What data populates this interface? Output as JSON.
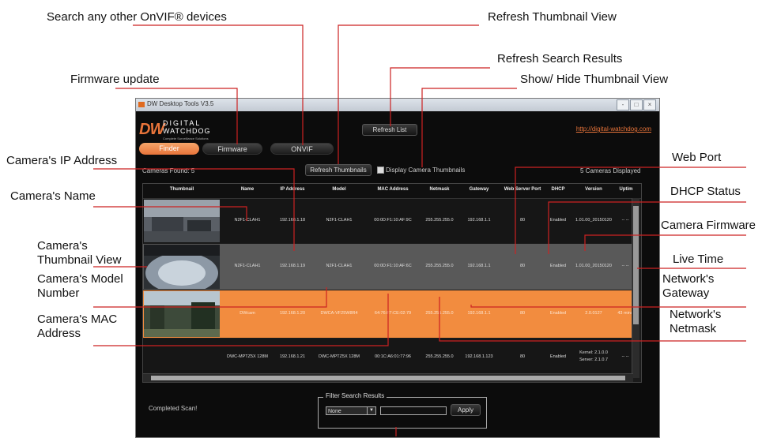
{
  "annotations": {
    "search_onvif": "Search any other OnVIF® devices",
    "refresh_thumbnail_view": "Refresh Thumbnail View",
    "refresh_search_results": "Refresh Search Results",
    "firmware_update": "Firmware update",
    "show_hide_thumbnail": "Show/ Hide Thumbnail View",
    "camera_ip": "Camera's IP Address",
    "web_port": "Web Port",
    "camera_name": "Camera's Name",
    "dhcp_status": "DHCP Status",
    "camera_firmware": "Camera Firmware",
    "thumbnail_view": "Camera's Thumbnail View",
    "live_time": "Live Time",
    "model_number": "Camera's Model Number",
    "network_gateway": "Network's Gateway",
    "mac_address": "Camera's MAC Address",
    "network_netmask": "Network's Netmask"
  },
  "window": {
    "title": "DW Desktop Tools V3.5",
    "controls": [
      "-",
      "□",
      "×"
    ]
  },
  "logo": {
    "mark": "DW",
    "line1": "DIGITAL",
    "line2": "WATCHDOG",
    "tagline": "Complete Surveillance Solutions"
  },
  "tabs": {
    "finder": "Finder",
    "firmware": "Firmware",
    "onvif": "ONVIF"
  },
  "toolbar": {
    "refresh_list": "Refresh List",
    "refresh_thumbnails": "Refresh Thumbnails",
    "display_thumbnails": "Display Camera Thumbnails",
    "link": "http://digital-watchdog.com",
    "cameras_found": "Cameras Found: 5",
    "cameras_displayed": "5 Cameras Displayed"
  },
  "table": {
    "headers": [
      "Thumbnail",
      "Name",
      "IP Address",
      "Model",
      "MAC Address",
      "Netmask",
      "Gateway",
      "Web Server Port",
      "DHCP",
      "Version",
      "Uptim"
    ],
    "rows": [
      [
        "N2F1-CLAH1",
        "192.168.1.18",
        "N2F1-CLAH1",
        "00:0D:F1:10:AF:9C",
        "255.255.255.0",
        "192.168.1.1",
        "80",
        "Enabled",
        "1.01.00_20150120",
        "-- --"
      ],
      [
        "N2F1-CLAH1",
        "192.168.1.19",
        "N2F1-CLAH1",
        "00:0D:F1:10:AF:6C",
        "255.255.255.0",
        "192.168.1.1",
        "80",
        "Enabled",
        "1.01.00_20150120",
        "-- --"
      ],
      [
        "DWcam",
        "192.168.1.20",
        "DWCA-VF25W8R4",
        "64:76:F7:CE:02:79",
        "255.255.255.0",
        "192.168.1.1",
        "80",
        "Enabled",
        "2.0.0127",
        "43 mins"
      ],
      [
        "DWC-MPTZ5X 128M",
        "192.168.1.21",
        "DWC-MPTZ5X 128M",
        "00:1C:A6:01:77:96",
        "255.255.255.0",
        "192.168.1.123",
        "80",
        "Enabled",
        "Kernel: 2.1.0.0",
        "-- --"
      ]
    ],
    "row4_version_line2": "Server: 2.1.0.7"
  },
  "status": {
    "text": "Completed Scan!"
  },
  "filter": {
    "title": "Filter Search Results",
    "select_value": "None",
    "apply": "Apply"
  },
  "colors": {
    "accent": "#e8743a",
    "background": "#0c0c0c",
    "annotation_line": "#cc2222"
  }
}
